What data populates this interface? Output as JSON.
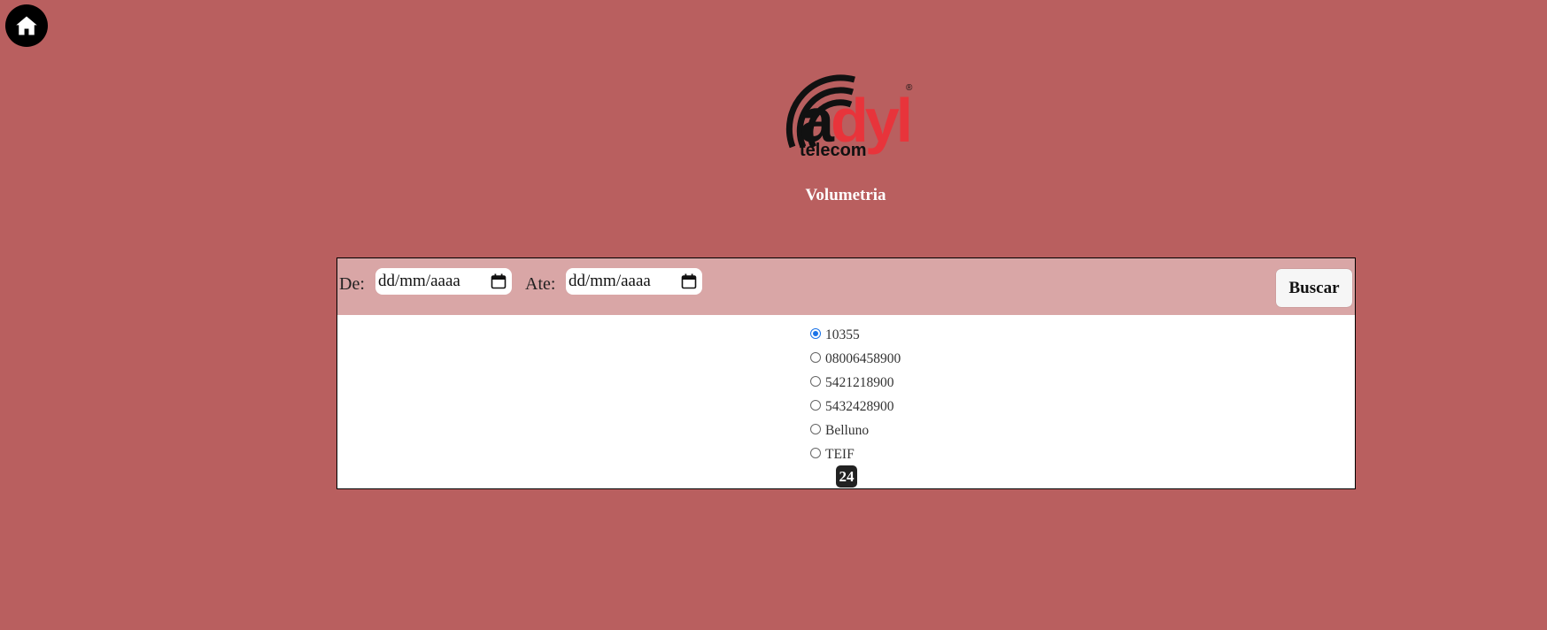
{
  "header": {
    "home_icon": "home-icon",
    "logo_text": "adyl",
    "logo_subtext": "telecom",
    "logo_mark": "®",
    "page_title": "Volumetria"
  },
  "filters": {
    "from_label": "De:",
    "from_value": "dd/mm/aaaa",
    "to_label": "Ate:",
    "to_value": "dd/mm/aaaa",
    "search_label": "Buscar"
  },
  "options": [
    {
      "label": "10355",
      "selected": true
    },
    {
      "label": "08006458900",
      "selected": false
    },
    {
      "label": "5421218900",
      "selected": false
    },
    {
      "label": "5432428900",
      "selected": false
    },
    {
      "label": "Belluno",
      "selected": false
    },
    {
      "label": "TEIF",
      "selected": false
    }
  ],
  "count": "24",
  "colors": {
    "background": "#b95f5f",
    "filter_bar": "#d9a6a6",
    "logo_dark": "#111111",
    "logo_red": "#e8343b"
  }
}
